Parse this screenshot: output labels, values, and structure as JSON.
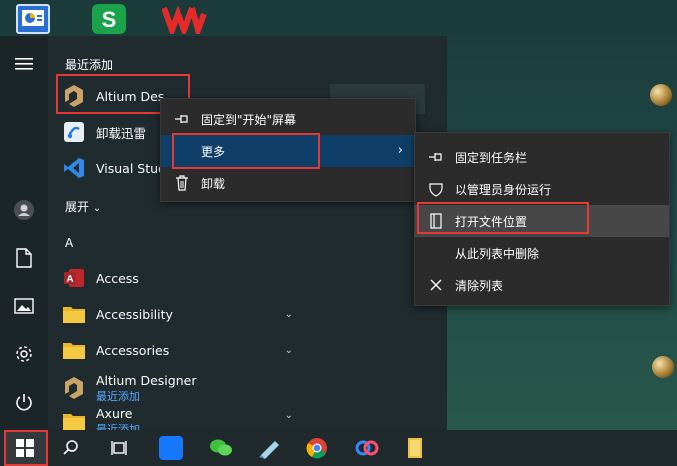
{
  "desktop": {
    "icons": [
      "chart-app-icon",
      "wps-spreadsheet-icon",
      "wps-office-icon"
    ]
  },
  "start_menu": {
    "recent_title": "最近添加",
    "expand_label": "展开",
    "letter_a": "A",
    "recent_apps": [
      {
        "name": "Altium Des",
        "icon": "altium-icon"
      },
      {
        "name": "卸载迅雷",
        "icon": "uninstall-thunder-icon"
      },
      {
        "name": "Visual Stud",
        "icon": "visual-studio-icon"
      }
    ],
    "apps": [
      {
        "name": "Access",
        "icon": "access-icon"
      },
      {
        "name": "Accessibility",
        "icon": "folder-icon"
      },
      {
        "name": "Accessories",
        "icon": "folder-icon"
      },
      {
        "name": "Altium Designer",
        "sub": "最近添加",
        "icon": "altium-icon"
      },
      {
        "name": "Axure",
        "sub": "最近添加",
        "icon": "folder-icon"
      }
    ]
  },
  "context_menu": {
    "pin_start": "固定到\"开始\"屏幕",
    "more": "更多",
    "uninstall": "卸载"
  },
  "submenu": {
    "pin_taskbar": "固定到任务栏",
    "run_admin": "以管理员身份运行",
    "open_location": "打开文件位置",
    "remove_list": "从此列表中删除",
    "clear_list": "清除列表"
  },
  "colors": {
    "selection_blue": "#0f3f68",
    "highlight_red": "#e53935",
    "accent_blue": "#5aa9ff"
  }
}
